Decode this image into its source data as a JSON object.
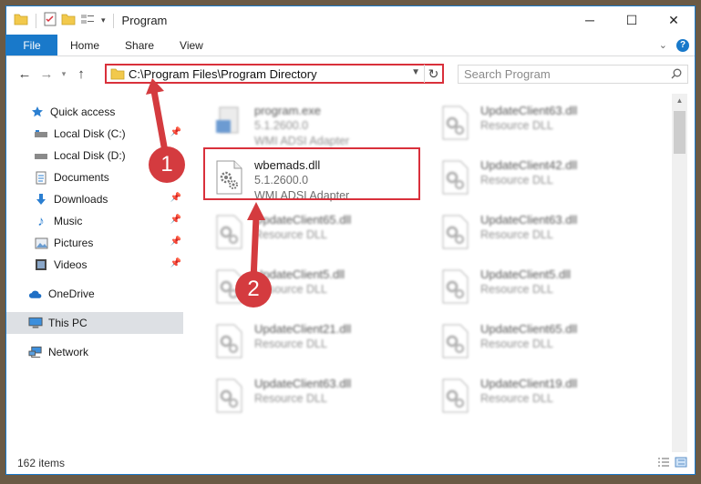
{
  "window": {
    "title": "Program",
    "controls": {
      "minimize": "─",
      "maximize": "☐",
      "close": "✕"
    }
  },
  "ribbon": {
    "file_tab": "File",
    "tabs": [
      "Home",
      "Share",
      "View"
    ]
  },
  "address": {
    "path": "C:\\Program Files\\Program Directory",
    "search_placeholder": "Search Program"
  },
  "nav": {
    "quick_access": "Quick access",
    "items": [
      {
        "label": "Local Disk (C:)",
        "icon": "drive-icon",
        "pinned": true
      },
      {
        "label": "Local Disk (D:)",
        "icon": "drive-icon",
        "pinned": false
      },
      {
        "label": "Documents",
        "icon": "documents-icon",
        "pinned": true
      },
      {
        "label": "Downloads",
        "icon": "downloads-icon",
        "pinned": true
      },
      {
        "label": "Music",
        "icon": "music-icon",
        "pinned": true
      },
      {
        "label": "Pictures",
        "icon": "pictures-icon",
        "pinned": true
      },
      {
        "label": "Videos",
        "icon": "videos-icon",
        "pinned": true
      }
    ],
    "onedrive": "OneDrive",
    "this_pc": "This PC",
    "network": "Network"
  },
  "files": {
    "left": [
      {
        "name": "program.exe",
        "line2": "5.1.2600.0",
        "line3": "WMI ADSI Adapter",
        "blurred": true
      },
      {
        "name": "wbemads.dll",
        "line2": "5.1.2600.0",
        "line3": "WMI ADSI Adapter",
        "blurred": false
      },
      {
        "name": "UpdateClient65.dll",
        "line2": "Resource DLL",
        "blurred": true
      },
      {
        "name": "UpdateClient5.dll",
        "line2": "Resource DLL",
        "blurred": true
      },
      {
        "name": "UpdateClient21.dll",
        "line2": "Resource DLL",
        "blurred": true
      },
      {
        "name": "UpdateClient63.dll",
        "line2": "Resource DLL",
        "blurred": true
      }
    ],
    "right": [
      {
        "name": "UpdateClient63.dll",
        "line2": "Resource DLL"
      },
      {
        "name": "UpdateClient42.dll",
        "line2": "Resource DLL"
      },
      {
        "name": "UpdateClient63.dll",
        "line2": "Resource DLL"
      },
      {
        "name": "UpdateClient5.dll",
        "line2": "Resource DLL"
      },
      {
        "name": "UpdateClient65.dll",
        "line2": "Resource DLL"
      },
      {
        "name": "UpdateClient19.dll",
        "line2": "Resource DLL"
      }
    ]
  },
  "status": {
    "count": "162 items"
  },
  "annotations": {
    "step1": "1",
    "step2": "2"
  },
  "colors": {
    "accent": "#1979ca",
    "highlight": "#d9303b",
    "callout": "#d43b3f"
  }
}
